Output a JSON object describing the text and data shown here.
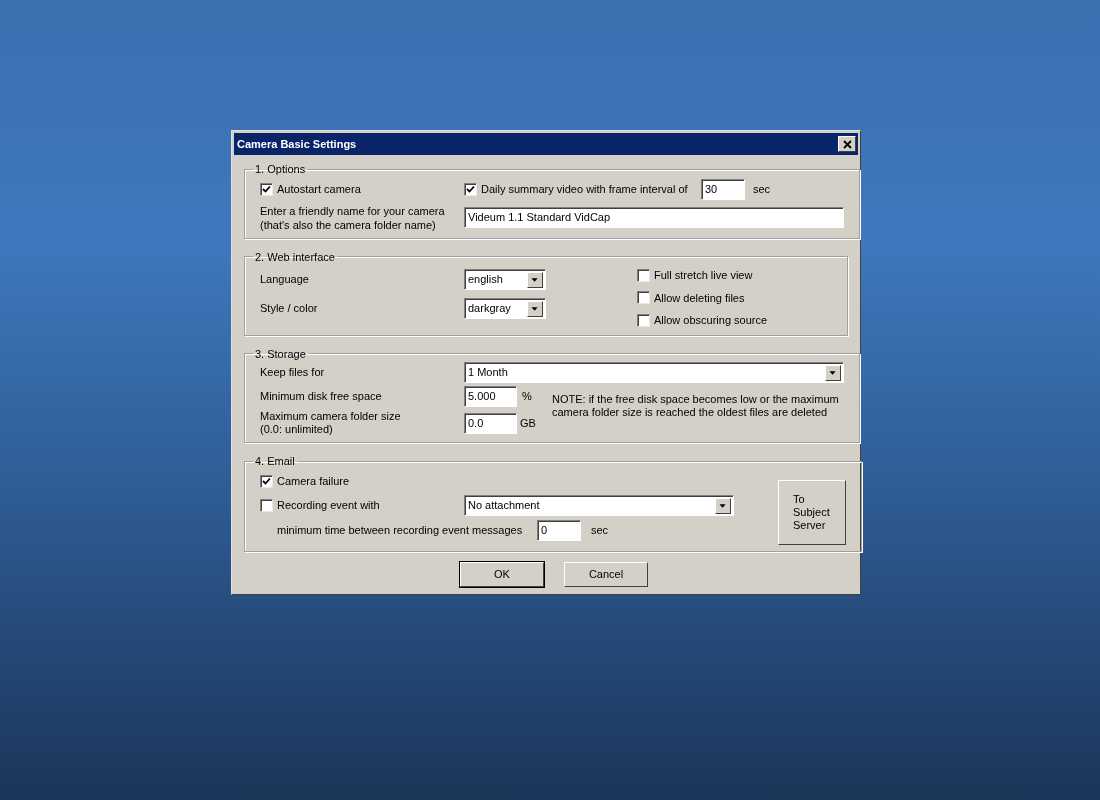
{
  "window": {
    "title": "Camera Basic Settings"
  },
  "options": {
    "legend": "1. Options",
    "autostart": {
      "label": "Autostart camera",
      "checked": true
    },
    "daily_summary": {
      "label": "Daily summary video with frame interval of",
      "checked": true,
      "value": "30",
      "unit": "sec"
    },
    "name_label": [
      "Enter a friendly name for your camera",
      "(that's also the camera folder name)"
    ],
    "name_value": "Videum 1.1 Standard VidCap"
  },
  "web_interface": {
    "legend": "2. Web interface",
    "selects": [
      {
        "label": "Language",
        "value": "english"
      },
      {
        "label": "Style / color",
        "value": "darkgray"
      }
    ],
    "checkboxes": [
      {
        "label": "Full stretch live view",
        "checked": false
      },
      {
        "label": "Allow deleting files",
        "checked": false
      },
      {
        "label": "Allow obscuring source",
        "checked": false
      }
    ]
  },
  "storage": {
    "legend": "3. Storage",
    "keep_files": {
      "label": "Keep files for",
      "value": "1 Month"
    },
    "min_disk": {
      "label": "Minimum disk free space",
      "value": "5.000",
      "unit": "%"
    },
    "max_folder": {
      "label": [
        "Maximum camera folder size",
        "(0.0: unlimited)"
      ],
      "value": "0.0",
      "unit": "GB"
    },
    "note": [
      "NOTE: if the free disk space becomes low or the maximum",
      "camera folder size is reached the oldest files are deleted"
    ]
  },
  "email": {
    "legend": "4. Email",
    "camera_failure": {
      "label": "Camera failure",
      "checked": true
    },
    "recording_event": {
      "label": "Recording event with",
      "checked": false,
      "attachment": "No attachment"
    },
    "min_time": {
      "label": "minimum time between recording event messages",
      "value": "0",
      "unit": "sec"
    },
    "server_button": [
      "To",
      "Subject",
      "Server"
    ]
  },
  "buttons": [
    {
      "label": "OK",
      "default": true
    },
    {
      "label": "Cancel",
      "default": false
    }
  ]
}
